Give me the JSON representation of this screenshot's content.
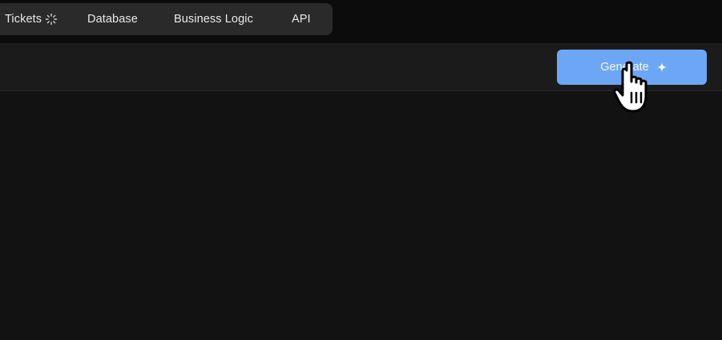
{
  "tabs": [
    {
      "label": "Tickets",
      "icon": "spinner-icon"
    },
    {
      "label": "Database"
    },
    {
      "label": "Business Logic"
    },
    {
      "label": "API"
    }
  ],
  "toolbar": {
    "generate_label": "Generate",
    "generate_icon": "sparkle-icon"
  },
  "colors": {
    "page_bg": "#121212",
    "tab_bar_bg": "#2a2a2a",
    "toolbar_bg": "#1b1b1b",
    "accent": "#6ea6f6"
  }
}
